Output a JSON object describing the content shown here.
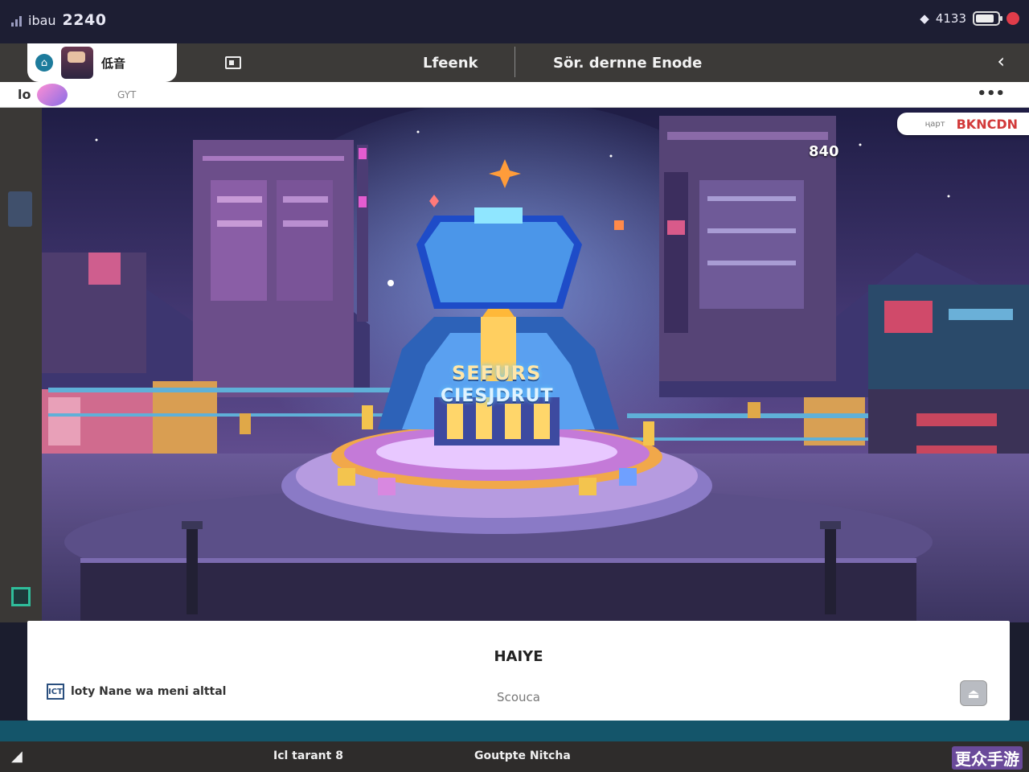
{
  "status_bar": {
    "left_text": "ibau",
    "clock": "2240",
    "right_text": "4133",
    "icons": [
      "signal-icon",
      "wifi-icon",
      "battery-icon",
      "alert-icon"
    ]
  },
  "top_nav": {
    "profile_name": "低音",
    "tabs": [
      "Lfeenk",
      "Sör. dernne Enode"
    ]
  },
  "sub_bar": {
    "label": "lo",
    "hint": "GYT",
    "more": "•••"
  },
  "right_badge": {
    "small": "ңарт",
    "highlight": "BKNCDN"
  },
  "scene": {
    "score": "840",
    "sign_line1": "SEFURS",
    "sign_line2": "CIESJDRUT"
  },
  "info_panel": {
    "title": "HAIYE",
    "subtitle": "Scouca",
    "detail_icon": "ICT",
    "detail_text": "loty Nane wa meni alttal"
  },
  "bottom_bar": {
    "item1": "Icl tarant 8",
    "item2": "Goutpte Nitcha",
    "watermark": "更众手游"
  },
  "colors": {
    "status_bg": "#1d1e33",
    "nav_bg": "#3c3a38",
    "accent_red": "#d23a3a",
    "teal_strip": "#14556a",
    "scene_sky": "#2b2550"
  }
}
